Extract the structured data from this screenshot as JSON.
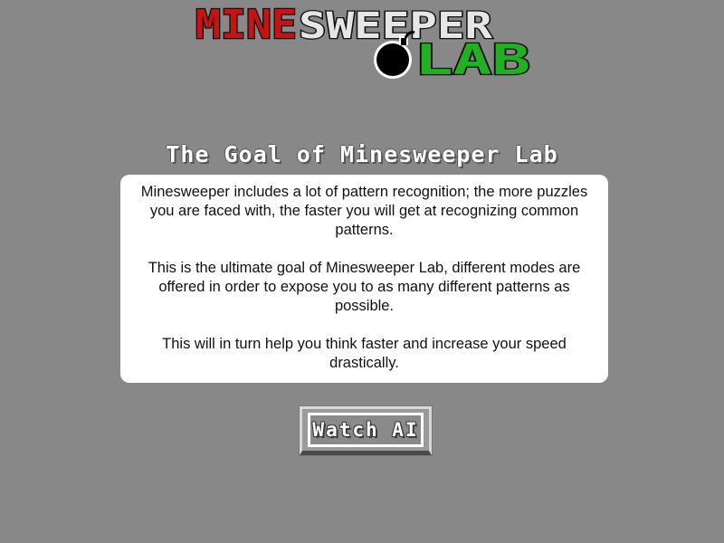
{
  "logo": {
    "word_mine": "MINE",
    "word_sweeper": "SWEEPER",
    "word_lab": "LAB",
    "colors": {
      "mine": "#c41414",
      "sweeper": "#e6e6e6",
      "lab": "#22b022",
      "outline": "#111111"
    }
  },
  "heading": "The Goal of Minesweeper Lab",
  "card": {
    "paragraphs": [
      "Minesweeper includes a lot of pattern recognition; the more puzzles you are faced with, the faster you will get at recognizing common patterns.",
      "This is the ultimate goal of Minesweeper Lab, different modes are offered in order to expose you to as many different patterns as possible.",
      "This will in turn help you think faster and increase your speed drastically."
    ]
  },
  "watch_button": {
    "label": "Watch AI"
  },
  "colors": {
    "background": "#888888",
    "card": "#ffffff"
  }
}
